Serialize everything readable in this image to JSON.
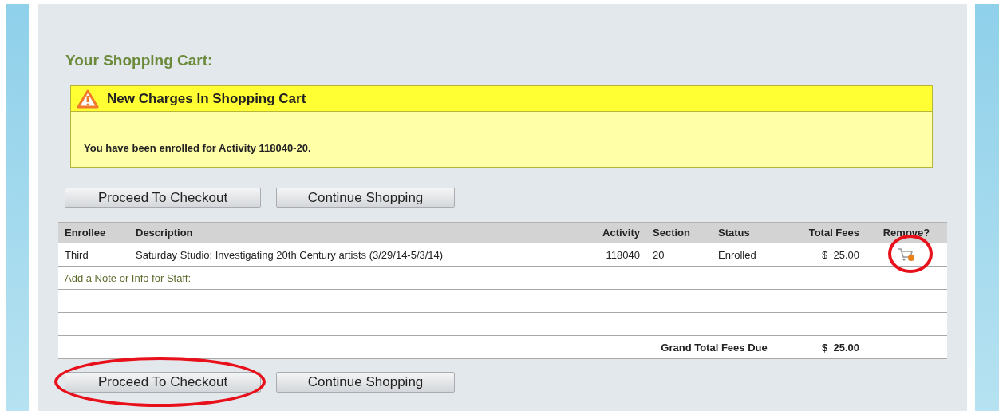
{
  "heading": "Your Shopping Cart:",
  "alert": {
    "title": "New Charges In Shopping Cart",
    "message": "You have been enrolled for Activity 118040-20."
  },
  "buttons_top": [
    {
      "label": "Proceed To Checkout",
      "highlighted": false
    },
    {
      "label": "Continue Shopping",
      "highlighted": false
    }
  ],
  "table": {
    "columns": [
      "Enrollee",
      "Description",
      "Activity",
      "Section",
      "Status",
      "Total Fees",
      "Remove?"
    ],
    "rows": [
      {
        "enrollee": "Third",
        "description": "Saturday Studio: Investigating 20th Century artists (3/29/14-5/3/14)",
        "activity": "118040",
        "section": "20",
        "status": "Enrolled",
        "total_fees": "$  25.00",
        "remove_highlighted": true
      }
    ],
    "note_link": "Add a Note or Info for Staff:",
    "grand_total_label": "Grand Total Fees Due",
    "grand_total": "$  25.00"
  },
  "buttons_bottom": [
    {
      "label": "Proceed To Checkout",
      "highlighted": true
    },
    {
      "label": "Continue Shopping",
      "highlighted": false
    }
  ]
}
